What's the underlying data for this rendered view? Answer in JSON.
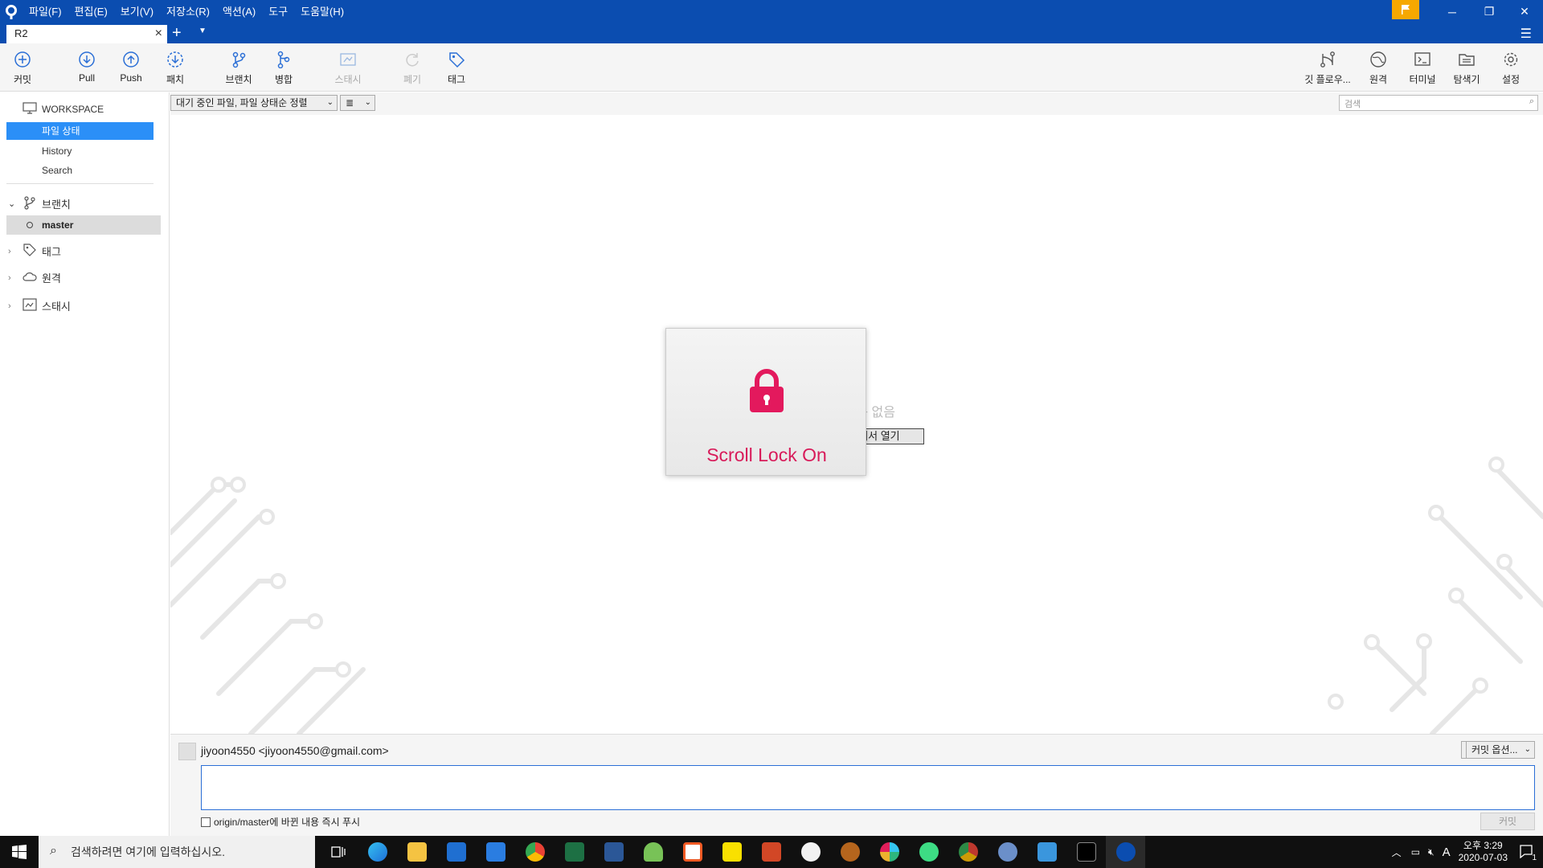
{
  "titlebar": {
    "menu": [
      "파일(F)",
      "편집(E)",
      "보기(V)",
      "저장소(R)",
      "액션(A)",
      "도구",
      "도움말(H)"
    ]
  },
  "tabs": {
    "active": "R2"
  },
  "toolbar": {
    "commit": "커밋",
    "pull": "Pull",
    "push": "Push",
    "fetch": "패치",
    "branch": "브랜치",
    "merge": "병합",
    "stash": "스태시",
    "discard": "폐기",
    "tag": "태그",
    "gitflow": "깃 플로우...",
    "remote": "원격",
    "terminal": "터미널",
    "explorer": "탐색기",
    "settings": "설정"
  },
  "sidebar": {
    "workspace": "WORKSPACE",
    "file_status": "파일 상태",
    "history": "History",
    "search": "Search",
    "branches": "브랜치",
    "current_branch": "master",
    "tags": "태그",
    "remotes": "원격",
    "stashes": "스태시"
  },
  "filter": {
    "sort": "대기 중인 파일, 파일 상태순 정렬",
    "view": "≣",
    "search_placeholder": "검색"
  },
  "content": {
    "empty_message": "커밋할 내용 없음",
    "open_explorer": "익스플로러에서 열기"
  },
  "overlay": {
    "text": "Scroll Lock On"
  },
  "commit": {
    "author": "jiyoon4550 <jiyoon4550@gmail.com>",
    "options": "커밋 옵션...",
    "push_label": "origin/master에 바뀐 내용 즉시 푸시",
    "button": "커밋"
  },
  "taskbar": {
    "search_placeholder": "검색하려면 여기에 입력하십시오.",
    "time": "오후 3:29",
    "date": "2020-07-03",
    "ime": "A",
    "notifications": "1"
  },
  "colors": {
    "titlebar": "#0b4db0",
    "accent": "#2b8ff7",
    "scroll_lock": "#d81b5a",
    "flag": "#f6a800"
  }
}
